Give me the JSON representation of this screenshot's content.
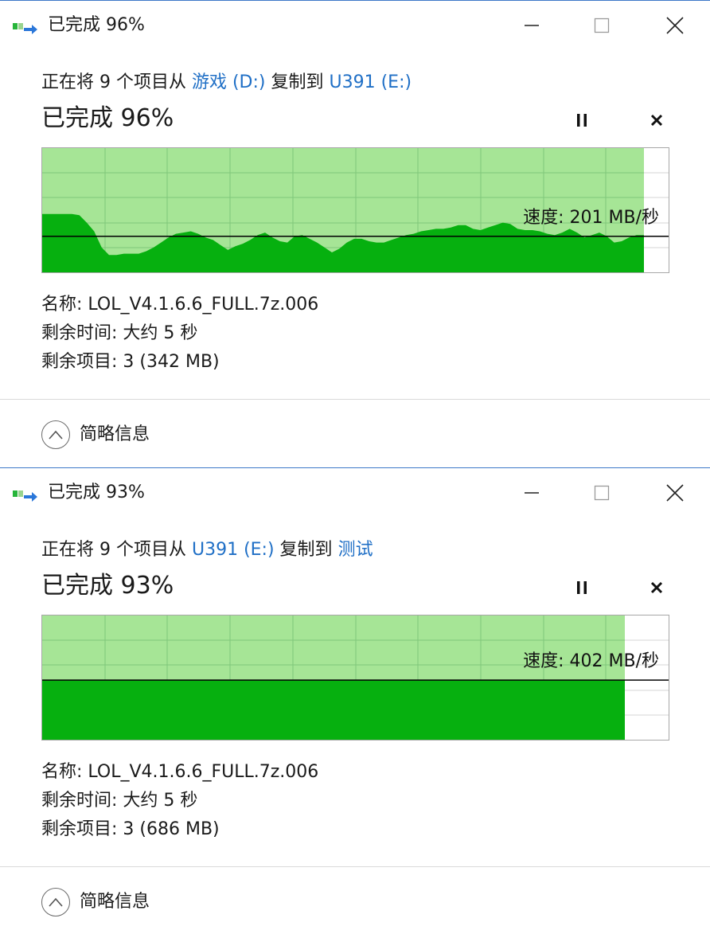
{
  "colors": {
    "accent_link": "#1f6fc6",
    "graph_fill_light": "#a6e596",
    "graph_fill_dark": "#06b00f",
    "graph_grid": "#7fc77a",
    "speed_line": "#000000",
    "window_border": "#3c78c8"
  },
  "dialogs": [
    {
      "title": "已完成 96%",
      "icon": "copy-transfer-icon",
      "copy_prefix": "正在将 9 个项目从 ",
      "source": "游戏 (D:)",
      "copy_middle": " 复制到 ",
      "destination": "U391 (E:)",
      "percent_text": "已完成 96%",
      "progress": 0.96,
      "speed_label": "速度: 201 MB/秒",
      "speed_mb_s": 201,
      "speed_line_level": 0.29,
      "graph_levels": [
        0.47,
        0.47,
        0.47,
        0.47,
        0.47,
        0.46,
        0.4,
        0.33,
        0.2,
        0.14,
        0.14,
        0.15,
        0.15,
        0.15,
        0.17,
        0.2,
        0.24,
        0.28,
        0.31,
        0.32,
        0.33,
        0.31,
        0.28,
        0.26,
        0.22,
        0.18,
        0.21,
        0.23,
        0.26,
        0.3,
        0.32,
        0.28,
        0.25,
        0.24,
        0.29,
        0.3,
        0.27,
        0.24,
        0.2,
        0.16,
        0.19,
        0.24,
        0.27,
        0.27,
        0.25,
        0.24,
        0.24,
        0.26,
        0.28,
        0.3,
        0.31,
        0.33,
        0.34,
        0.35,
        0.35,
        0.36,
        0.38,
        0.38,
        0.35,
        0.34,
        0.36,
        0.38,
        0.4,
        0.39,
        0.35,
        0.34,
        0.34,
        0.33,
        0.31,
        0.3,
        0.32,
        0.35,
        0.32,
        0.28,
        0.3,
        0.32,
        0.29,
        0.24,
        0.25,
        0.28,
        0.3,
        0.3
      ],
      "name_label": "名称: ",
      "name_value": "LOL_V4.1.6.6_FULL.7z.006",
      "time_label": "剩余时间: ",
      "time_value": "大约 5 秒",
      "items_label": "剩余项目: ",
      "items_value": "3 (342 MB)",
      "details_toggle": "简略信息"
    },
    {
      "title": "已完成 93%",
      "icon": "copy-transfer-icon",
      "copy_prefix": "正在将 9 个项目从 ",
      "source": "U391 (E:)",
      "copy_middle": " 复制到 ",
      "destination": "测试",
      "percent_text": "已完成 93%",
      "progress": 0.93,
      "speed_label": "速度: 402 MB/秒",
      "speed_mb_s": 402,
      "speed_line_level": 0.48,
      "graph_levels": [
        0.48,
        0.48,
        0.48,
        0.48,
        0.48,
        0.48,
        0.48,
        0.48,
        0.48,
        0.48,
        0.48,
        0.48
      ],
      "name_label": "名称: ",
      "name_value": "LOL_V4.1.6.6_FULL.7z.006",
      "time_label": "剩余时间: ",
      "time_value": "大约 5 秒",
      "items_label": "剩余项目: ",
      "items_value": "3 (686 MB)",
      "details_toggle": "简略信息"
    }
  ]
}
